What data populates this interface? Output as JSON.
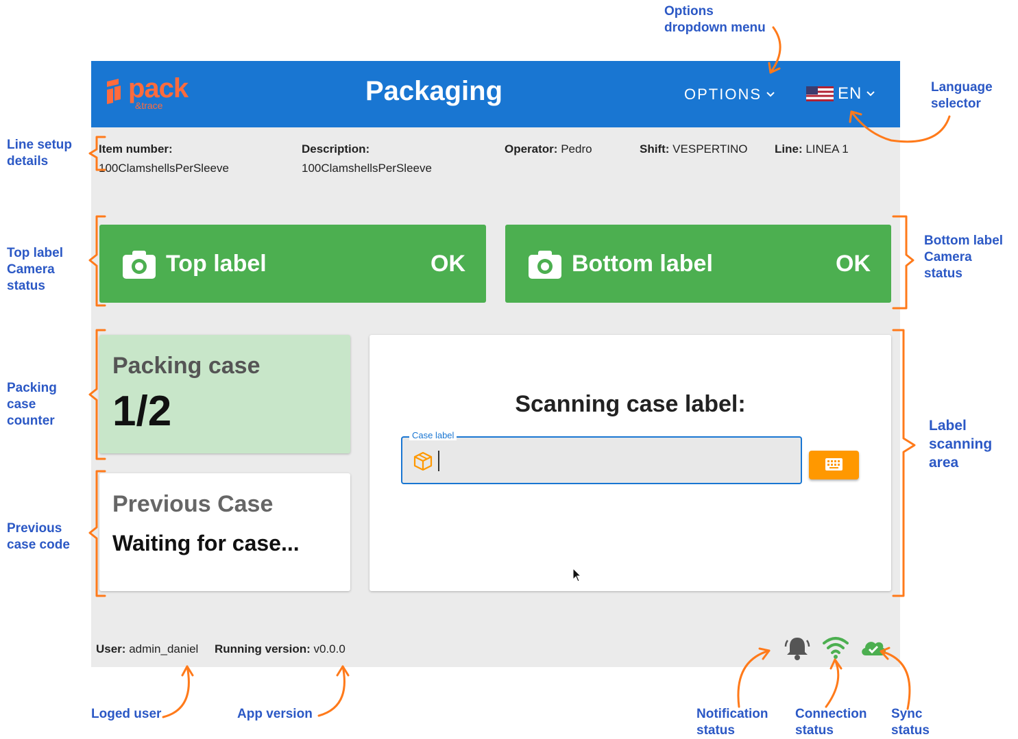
{
  "header": {
    "logo_text": "pack",
    "logo_subtext": "&trace",
    "title": "Packaging",
    "options_label": "OPTIONS",
    "language_label": "EN",
    "language_flag": "us-flag"
  },
  "line_setup": {
    "item_number_label": "Item number:",
    "item_number_value": "100ClamshellsPerSleeve",
    "description_label": "Description:",
    "description_value": "100ClamshellsPerSleeve",
    "operator_label": "Operator:",
    "operator_value": "Pedro",
    "shift_label": "Shift:",
    "shift_value": "VESPERTINO",
    "line_label": "Line:",
    "line_value": "LINEA 1"
  },
  "cameras": {
    "top": {
      "label": "Top label",
      "status": "OK"
    },
    "bottom": {
      "label": "Bottom label",
      "status": "OK"
    },
    "ok_color": "#4caf50"
  },
  "packing_case": {
    "title": "Packing case",
    "counter": "1/2"
  },
  "previous_case": {
    "title": "Previous Case",
    "value": "Waiting for case..."
  },
  "scanning": {
    "title": "Scanning case label:",
    "field_label": "Case label",
    "field_value": "",
    "field_icon": "box-icon",
    "keyboard_icon": "keyboard-icon"
  },
  "footer": {
    "user_label": "User:",
    "user_value": "admin_daniel",
    "version_label": "Running version:",
    "version_value": "v0.0.0",
    "icons": [
      "bell-icon",
      "wifi-icon",
      "cloud-check-icon"
    ]
  },
  "colors": {
    "brand_blue": "#1976d2",
    "logo_orange": "#ff6b3d",
    "camera_ok": "#4caf50",
    "packing_bg": "#c8e6c9",
    "keyboard_button": "#ff9800",
    "annotation_text": "#2b58c5",
    "annotation_arrow": "#ff7a1a"
  },
  "annotations": {
    "options_menu": [
      "Options",
      "dropdown menu"
    ],
    "language_selector": [
      "Language",
      "selector"
    ],
    "line_setup": [
      "Line setup",
      "details"
    ],
    "top_camera": [
      "Top label",
      "Camera",
      "status"
    ],
    "bottom_camera": [
      "Bottom label",
      "Camera",
      "status"
    ],
    "packing_counter": [
      "Packing",
      "case",
      "counter"
    ],
    "previous_code": [
      "Previous",
      "case code"
    ],
    "scanning_area": [
      "Label",
      "scanning",
      "area"
    ],
    "logged_user": [
      "Loged user"
    ],
    "app_version": [
      "App version"
    ],
    "notification_status": [
      "Notification",
      "status"
    ],
    "connection_status": [
      "Connection",
      "status"
    ],
    "sync_status": [
      "Sync",
      "status"
    ]
  }
}
